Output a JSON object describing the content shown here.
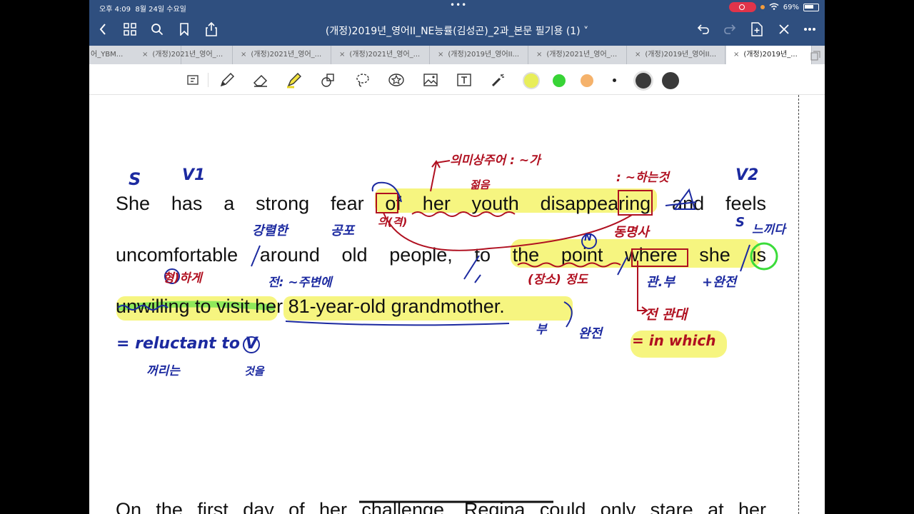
{
  "status": {
    "time": "오후 4:09",
    "date": "8월 24일 수요일",
    "battery": "69%"
  },
  "document": {
    "title": "(개정)2019년_영어II_NE능률(김성곤)_2과_본문 필기용 (1) ˅"
  },
  "tabs": [
    {
      "label": "어_YBM..."
    },
    {
      "label": "(개정)2021년_영어_..."
    },
    {
      "label": "(개정)2021년_영어_..."
    },
    {
      "label": "(개정)2021년_영어_..."
    },
    {
      "label": "(개정)2019년_영어II..."
    },
    {
      "label": "(개정)2021년_영어_..."
    },
    {
      "label": "(개정)2019년_영어II..."
    },
    {
      "label": "(개정)2019년_..."
    }
  ],
  "tools": {
    "colors": [
      "#e8ee5a",
      "#38d436",
      "#f5b26b",
      "#222222",
      "#3a3a3a",
      "#3a3a3a"
    ]
  },
  "text_lines": [
    "She has a strong fear of her youth disappearing and feels",
    "uncomfortable around old people, to the point where she is",
    "unwilling to visit her 81-year-old grandmother.",
    "On the first day of her challenge, Regina could only stare at her"
  ],
  "notes": {
    "s1": "S",
    "v1": "V1",
    "v2": "V2",
    "s2": "S",
    "meaning_subject": "의미상주어 : ~가",
    "youth": "젊음",
    "ing_mark": ": ~하는것",
    "of_mark": "의(격)",
    "strong": "강렬한",
    "fear": "공포",
    "gerund": "동명사",
    "feel": "느끼다",
    "adj": "형)하게",
    "prep": "전: ~주변에",
    "place": "(장소) 정도",
    "rel_adv": "관.부",
    "complete": "+완전",
    "prep_rel": "전 관대",
    "in_which": "= in which",
    "n_mark": "N",
    "adverb": "부",
    "complete2": "완전",
    "reluctant": "= reluctant to V",
    "v_mark": "V",
    "unwilling": "꺼리는",
    "won": "것을"
  }
}
